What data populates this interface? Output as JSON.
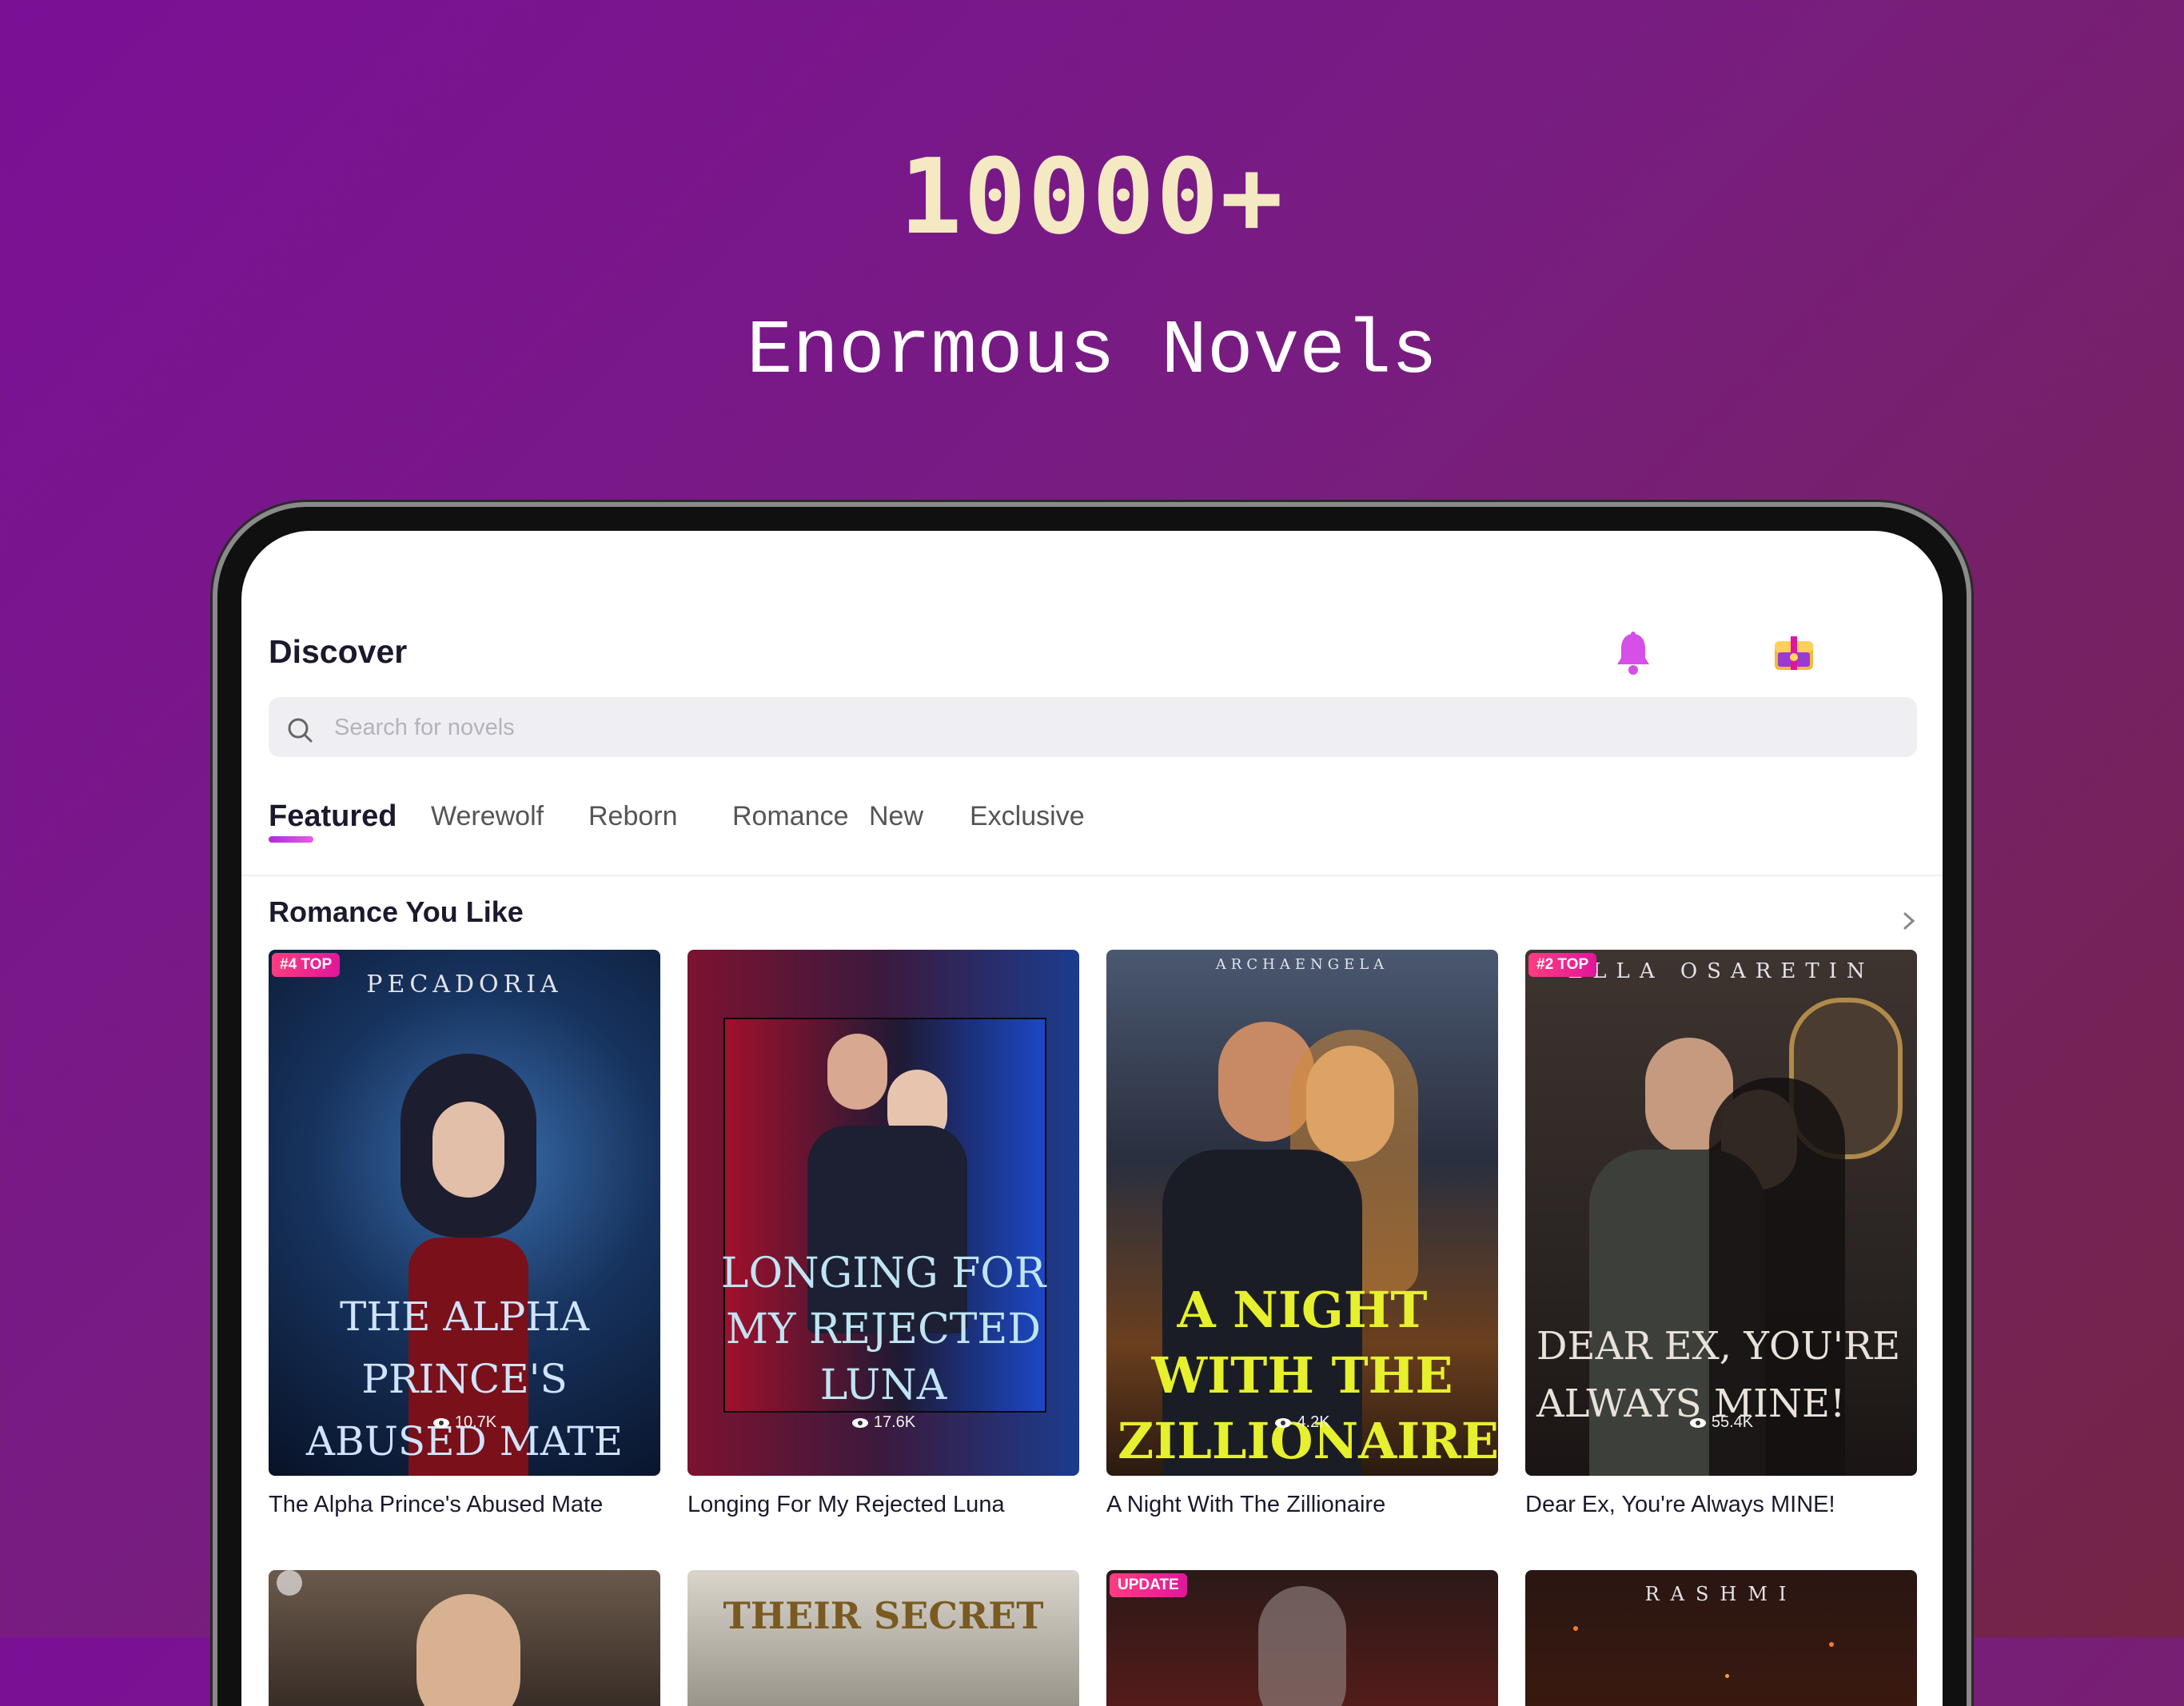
{
  "promo": {
    "headline": "10000+",
    "subheadline": "Enormous Novels"
  },
  "app": {
    "page_title": "Discover",
    "search": {
      "placeholder": "Search for novels"
    },
    "tabs": [
      {
        "label": "Featured",
        "active": true
      },
      {
        "label": "Werewolf"
      },
      {
        "label": "Reborn"
      },
      {
        "label": "Romance"
      },
      {
        "label": "New"
      },
      {
        "label": "Exclusive"
      }
    ],
    "section": {
      "title": "Romance You Like"
    },
    "books": [
      {
        "title": "The Alpha Prince's Abused Mate",
        "badge": "#4 TOP",
        "views": "10.7K",
        "cover_author": "PECADORIA",
        "cover_text": "THE ALPHA PRINCE'S ABUSED MATE"
      },
      {
        "title": "Longing For My Rejected Luna",
        "badge": "",
        "views": "17.6K",
        "cover_author": "",
        "cover_text": "LONGING FOR MY REJECTED LUNA"
      },
      {
        "title": "A Night With The Zillionaire",
        "badge": "",
        "views": "4.2K",
        "cover_author": "ARCHAENGELA",
        "cover_text": "A NIGHT WITH THE ZILLIONAIRE"
      },
      {
        "title": "Dear Ex, You're Always MINE!",
        "badge": "#2 TOP",
        "views": "55.4K",
        "cover_author": "ELLA OSARETIN",
        "cover_text": "DEAR EX, YOU'RE ALWAYS MINE!"
      }
    ],
    "row2": [
      {
        "badge": "",
        "cover_text": ""
      },
      {
        "badge": "",
        "cover_text": "THEIR SECRET"
      },
      {
        "badge": "UPDATE",
        "cover_text": ""
      },
      {
        "badge": "",
        "cover_author": "RASHMI",
        "cover_text": ""
      }
    ]
  },
  "colors": {
    "background_start": "#7a1096",
    "background_end": "#742544",
    "headline": "#f4e9c2",
    "accent": "#e0169b",
    "bell": "#d64fe6"
  },
  "icons": [
    "bell-icon",
    "gift-chest-icon",
    "search-icon",
    "chevron-right-icon",
    "eye-icon"
  ]
}
